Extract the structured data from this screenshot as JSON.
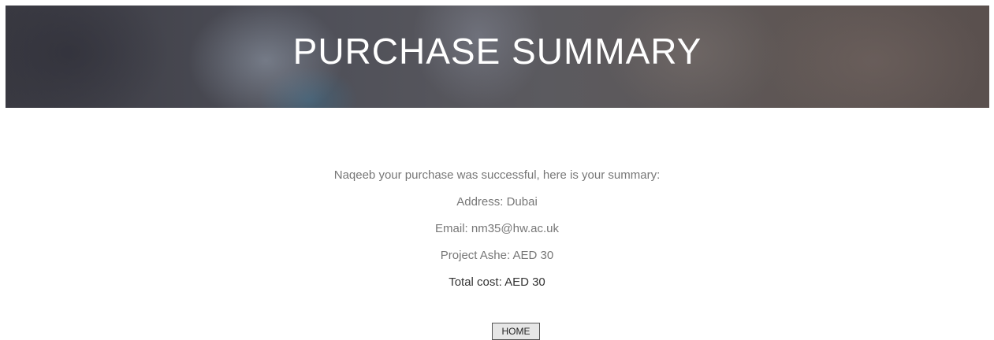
{
  "header": {
    "title": "PURCHASE SUMMARY"
  },
  "summary": {
    "message": "Naqeeb your purchase was successful, here is your summary:",
    "address": "Address: Dubai",
    "email": "Email: nm35@hw.ac.uk",
    "item": "Project Ashe: AED 30",
    "total": "Total cost: AED 30"
  },
  "actions": {
    "home_label": "HOME"
  }
}
